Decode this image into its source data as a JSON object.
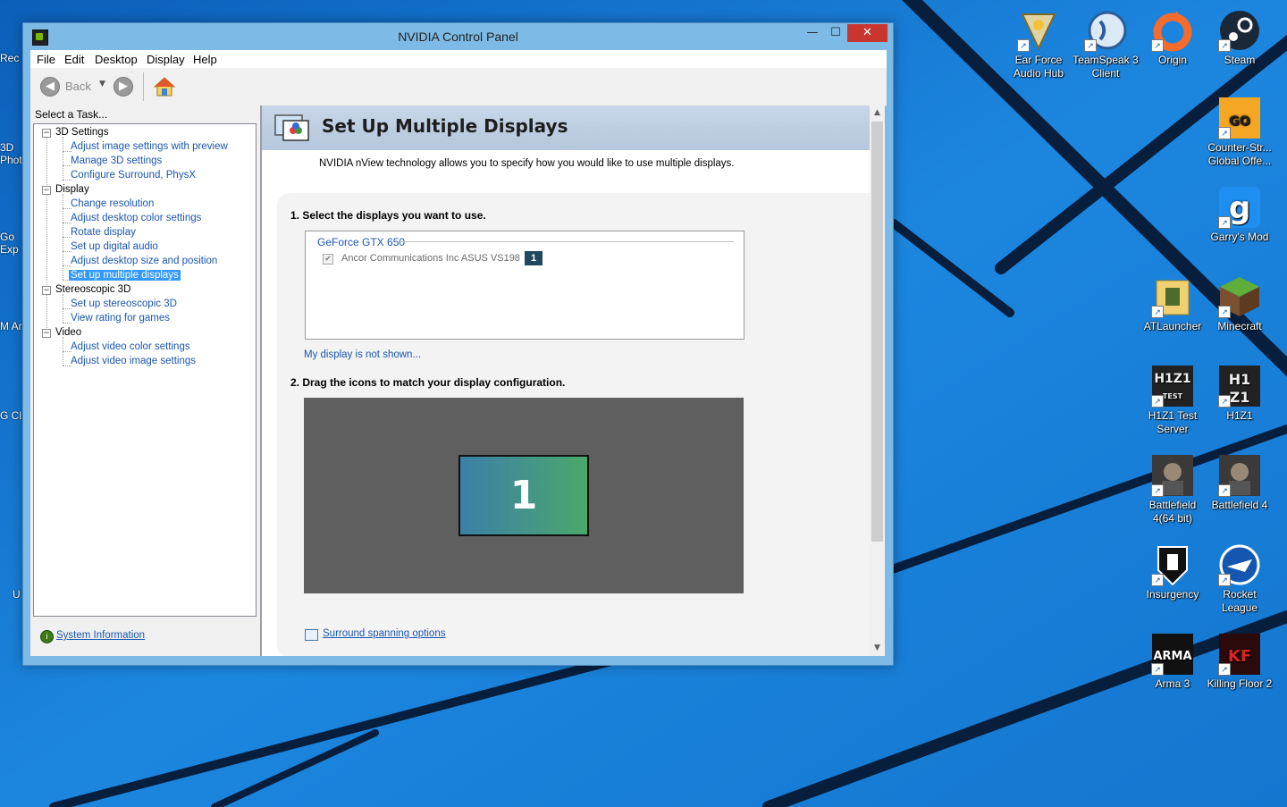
{
  "window": {
    "title": "NVIDIA Control Panel",
    "minimize": "—",
    "maximize": "☐",
    "close": "✕"
  },
  "menu": [
    "File",
    "Edit",
    "Desktop",
    "Display",
    "Help"
  ],
  "toolbar": {
    "back_label": "Back"
  },
  "left_pane": {
    "header": "Select a Task...",
    "tree": [
      {
        "label": "3D Settings",
        "children": [
          "Adjust image settings with preview",
          "Manage 3D settings",
          "Configure Surround, PhysX"
        ]
      },
      {
        "label": "Display",
        "children": [
          "Change resolution",
          "Adjust desktop color settings",
          "Rotate display",
          "Set up digital audio",
          "Adjust desktop size and position",
          "Set up multiple displays"
        ]
      },
      {
        "label": "Stereoscopic 3D",
        "children": [
          "Set up stereoscopic 3D",
          "View rating for games"
        ]
      },
      {
        "label": "Video",
        "children": [
          "Adjust video color settings",
          "Adjust video image settings"
        ]
      }
    ],
    "selected": "Set up multiple displays",
    "system_info": "System Information"
  },
  "page": {
    "title": "Set Up Multiple Displays",
    "description": "NVIDIA nView technology allows you to specify how you would like to use multiple displays.",
    "step1": "1. Select the displays you want to use.",
    "gpu_name": "GeForce GTX 650",
    "display_name": "Ancor Communications Inc ASUS VS198",
    "display_checked": true,
    "display_badge": "1",
    "not_shown_link": "My display is not shown...",
    "step2": "2. Drag the icons to match your display configuration.",
    "monitor_tile": "1",
    "surround_link": "Surround spanning options"
  },
  "desktop_icons": [
    {
      "id": "ear-force",
      "label": "Ear Force Audio Hub",
      "icon": "ear-force-icon"
    },
    {
      "id": "teamspeak",
      "label": "TeamSpeak 3 Client",
      "icon": "teamspeak-icon"
    },
    {
      "id": "origin",
      "label": "Origin",
      "icon": "origin-icon"
    },
    {
      "id": "steam",
      "label": "Steam",
      "icon": "steam-icon"
    },
    {
      "id": "csgo",
      "label": "Counter-Str... Global Offe...",
      "icon": "csgo-icon"
    },
    {
      "id": "gmod",
      "label": "Garry's Mod",
      "icon": "garrys-mod-icon"
    },
    {
      "id": "atlauncher",
      "label": "ATLauncher",
      "icon": "atlauncher-icon"
    },
    {
      "id": "minecraft",
      "label": "Minecraft",
      "icon": "minecraft-icon"
    },
    {
      "id": "h1z1-test",
      "label": "H1Z1 Test Server",
      "icon": "h1z1-test-icon"
    },
    {
      "id": "h1z1",
      "label": "H1Z1",
      "icon": "h1z1-icon"
    },
    {
      "id": "bf4-64",
      "label": "Battlefield 4(64 bit)",
      "icon": "battlefield-4-64-icon"
    },
    {
      "id": "bf4",
      "label": "Battlefield 4",
      "icon": "battlefield-4-icon"
    },
    {
      "id": "insurgency",
      "label": "Insurgency",
      "icon": "insurgency-icon"
    },
    {
      "id": "rocket-league",
      "label": "Rocket League",
      "icon": "rocket-league-icon"
    },
    {
      "id": "arma3",
      "label": "Arma 3",
      "icon": "arma-3-icon"
    },
    {
      "id": "killing-floor",
      "label": "Killing Floor 2",
      "icon": "killing-floor-2-icon"
    }
  ],
  "edge_labels": [
    "Rec",
    "3D Phot",
    "Go Exp",
    "M Ar",
    "G Cl",
    "U"
  ],
  "colors": {
    "desktop": "#1c7fd6",
    "accent": "#76b900",
    "selection": "#3399ff",
    "close": "#c7372f"
  }
}
